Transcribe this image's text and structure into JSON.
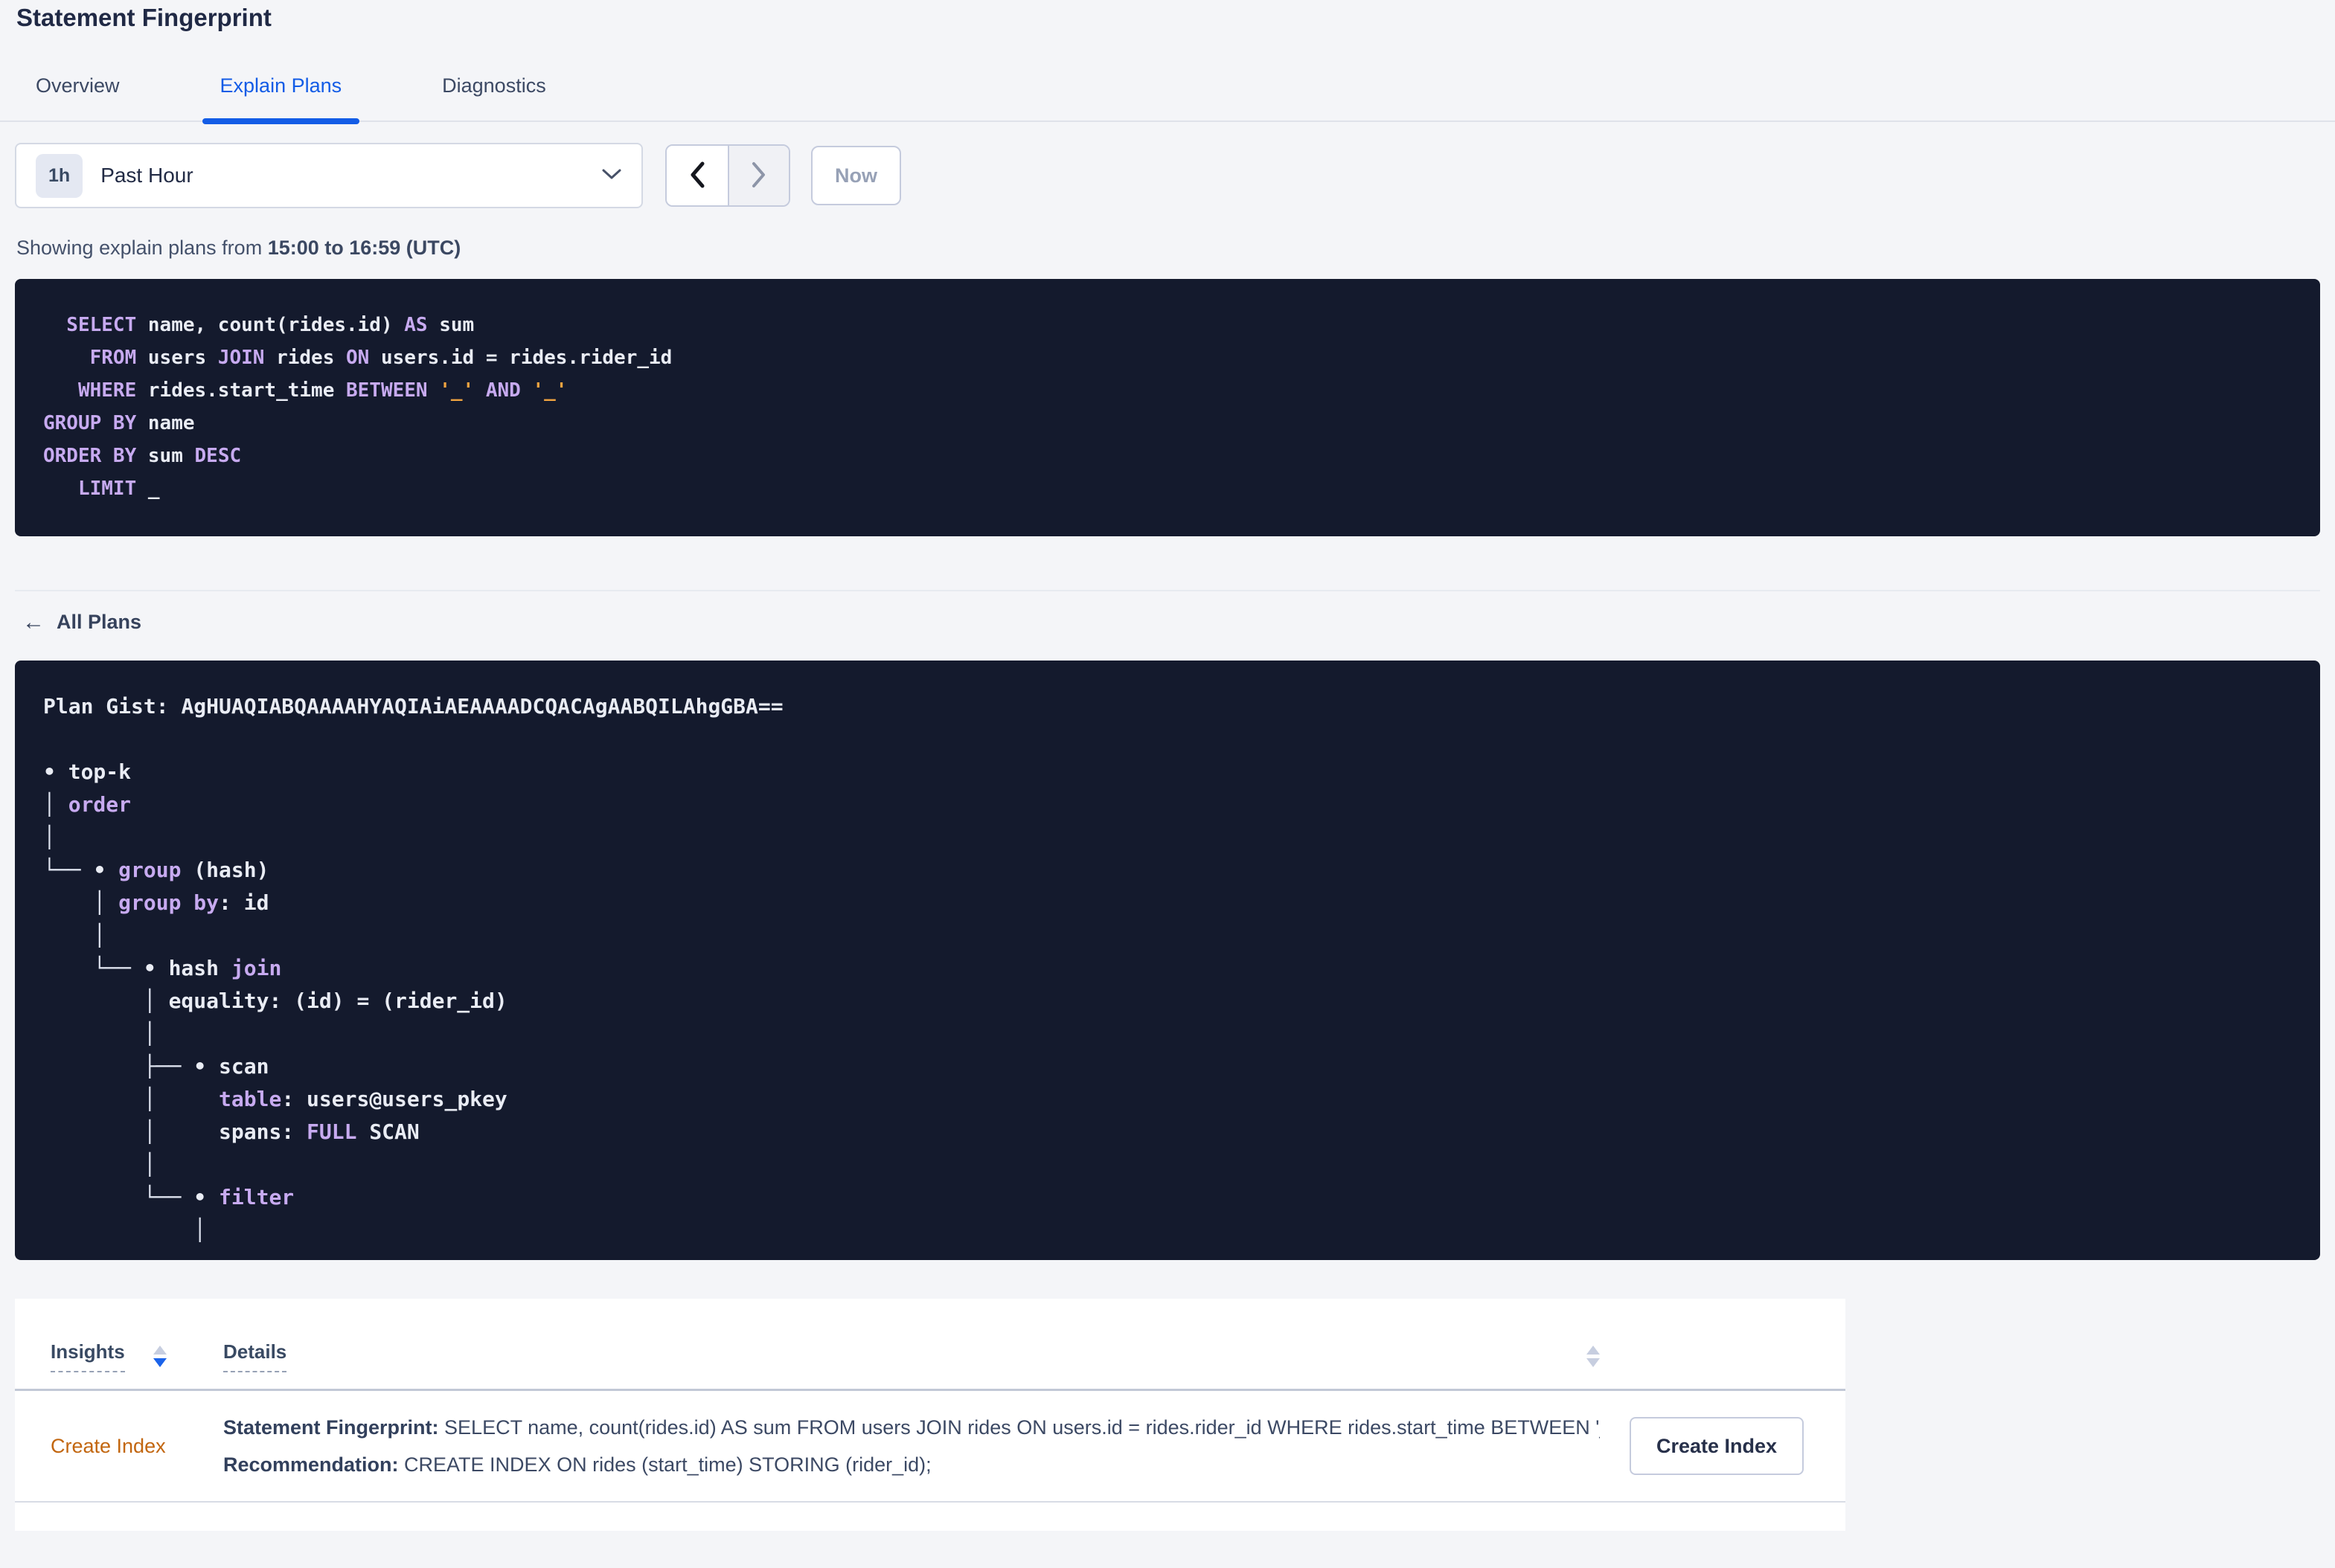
{
  "colors": {
    "accent_blue": "#135ce6",
    "panel_background": "#141a2d",
    "code_keyword_purple": "#c7aaf0",
    "code_literal_orange": "#efa340",
    "code_text": "#e9ecf4",
    "insight_link_orange": "#c2660f"
  },
  "page": {
    "title": "Statement Fingerprint"
  },
  "tabs": [
    {
      "label": "Overview",
      "active": false
    },
    {
      "label": "Explain Plans",
      "active": true
    },
    {
      "label": "Diagnostics",
      "active": false
    }
  ],
  "time_controls": {
    "interval_badge": "1h",
    "selected_range": "Past Hour",
    "now_button": "Now"
  },
  "caption": {
    "prefix": "Showing explain plans from ",
    "range_bold": "15:00 to 16:59 (UTC)"
  },
  "sql_statement": {
    "lines": [
      [
        {
          "c": "kw",
          "t": "  SELECT"
        },
        {
          "c": "tx",
          "t": " name, count(rides.id) "
        },
        {
          "c": "kw",
          "t": "AS"
        },
        {
          "c": "tx",
          "t": " sum"
        }
      ],
      [
        {
          "c": "kw",
          "t": "    FROM"
        },
        {
          "c": "tx",
          "t": " users "
        },
        {
          "c": "kw",
          "t": "JOIN"
        },
        {
          "c": "tx",
          "t": " rides "
        },
        {
          "c": "kw",
          "t": "ON"
        },
        {
          "c": "tx",
          "t": " users.id = rides.rider_id"
        }
      ],
      [
        {
          "c": "kw",
          "t": "   WHERE"
        },
        {
          "c": "tx",
          "t": " rides.start_time "
        },
        {
          "c": "kw",
          "t": "BETWEEN"
        },
        {
          "c": "tx",
          "t": " "
        },
        {
          "c": "str",
          "t": "'_'"
        },
        {
          "c": "tx",
          "t": " "
        },
        {
          "c": "kw",
          "t": "AND"
        },
        {
          "c": "tx",
          "t": " "
        },
        {
          "c": "str",
          "t": "'_'"
        }
      ],
      [
        {
          "c": "kw",
          "t": "GROUP BY"
        },
        {
          "c": "tx",
          "t": " name"
        }
      ],
      [
        {
          "c": "kw",
          "t": "ORDER BY"
        },
        {
          "c": "tx",
          "t": " sum "
        },
        {
          "c": "kw",
          "t": "DESC"
        }
      ],
      [
        {
          "c": "kw",
          "t": "   LIMIT"
        },
        {
          "c": "tx",
          "t": " _"
        }
      ]
    ]
  },
  "plans_nav": {
    "back_icon": "←",
    "back_label": "All Plans"
  },
  "plan_panel": {
    "gist_label": "Plan Gist:",
    "gist_value": "AgHUAQIABQAAAAHYAQIAiAEAAAADCQACAgAABQILAhgGBA==",
    "tree_lines": [
      [
        {
          "c": "tx",
          "t": "• top-k"
        }
      ],
      [
        {
          "c": "ln",
          "t": "│ "
        },
        {
          "c": "kw",
          "t": "order"
        }
      ],
      [
        {
          "c": "ln",
          "t": "│"
        }
      ],
      [
        {
          "c": "ln",
          "t": "└── "
        },
        {
          "c": "tx",
          "t": "• "
        },
        {
          "c": "kw",
          "t": "group"
        },
        {
          "c": "tx",
          "t": " (hash)"
        }
      ],
      [
        {
          "c": "ln",
          "t": "    │ "
        },
        {
          "c": "kw",
          "t": "group by"
        },
        {
          "c": "tx",
          "t": ": id"
        }
      ],
      [
        {
          "c": "ln",
          "t": "    │"
        }
      ],
      [
        {
          "c": "ln",
          "t": "    └── "
        },
        {
          "c": "tx",
          "t": "• hash "
        },
        {
          "c": "kw",
          "t": "join"
        }
      ],
      [
        {
          "c": "ln",
          "t": "        │ "
        },
        {
          "c": "tx",
          "t": "equality: (id) = (rider_id)"
        }
      ],
      [
        {
          "c": "ln",
          "t": "        │"
        }
      ],
      [
        {
          "c": "ln",
          "t": "        ├── "
        },
        {
          "c": "tx",
          "t": "• scan"
        }
      ],
      [
        {
          "c": "ln",
          "t": "        │     "
        },
        {
          "c": "kw",
          "t": "table"
        },
        {
          "c": "tx",
          "t": ": users@users_pkey"
        }
      ],
      [
        {
          "c": "ln",
          "t": "        │     "
        },
        {
          "c": "tx",
          "t": "spans: "
        },
        {
          "c": "kw",
          "t": "FULL"
        },
        {
          "c": "tx",
          "t": " SCAN"
        }
      ],
      [
        {
          "c": "ln",
          "t": "        │"
        }
      ],
      [
        {
          "c": "ln",
          "t": "        └── "
        },
        {
          "c": "tx",
          "t": "• "
        },
        {
          "c": "kw",
          "t": "filter"
        }
      ],
      [
        {
          "c": "ln",
          "t": "            │"
        }
      ]
    ]
  },
  "insights_table": {
    "columns": [
      {
        "label": "Insights",
        "sortable": true
      },
      {
        "label": "Details",
        "sortable": true
      }
    ],
    "rows": [
      {
        "insight": "Create Index",
        "details": {
          "fingerprint_label": "Statement Fingerprint:",
          "fingerprint_value": "SELECT name, count(rides.id) AS sum FROM users JOIN rides ON users.id = rides.rider_id WHERE rides.start_time BETWEEN '_...",
          "recommendation_label": "Recommendation:",
          "recommendation_value": "CREATE INDEX ON rides (start_time) STORING (rider_id);"
        },
        "action_button": "Create Index"
      }
    ]
  }
}
